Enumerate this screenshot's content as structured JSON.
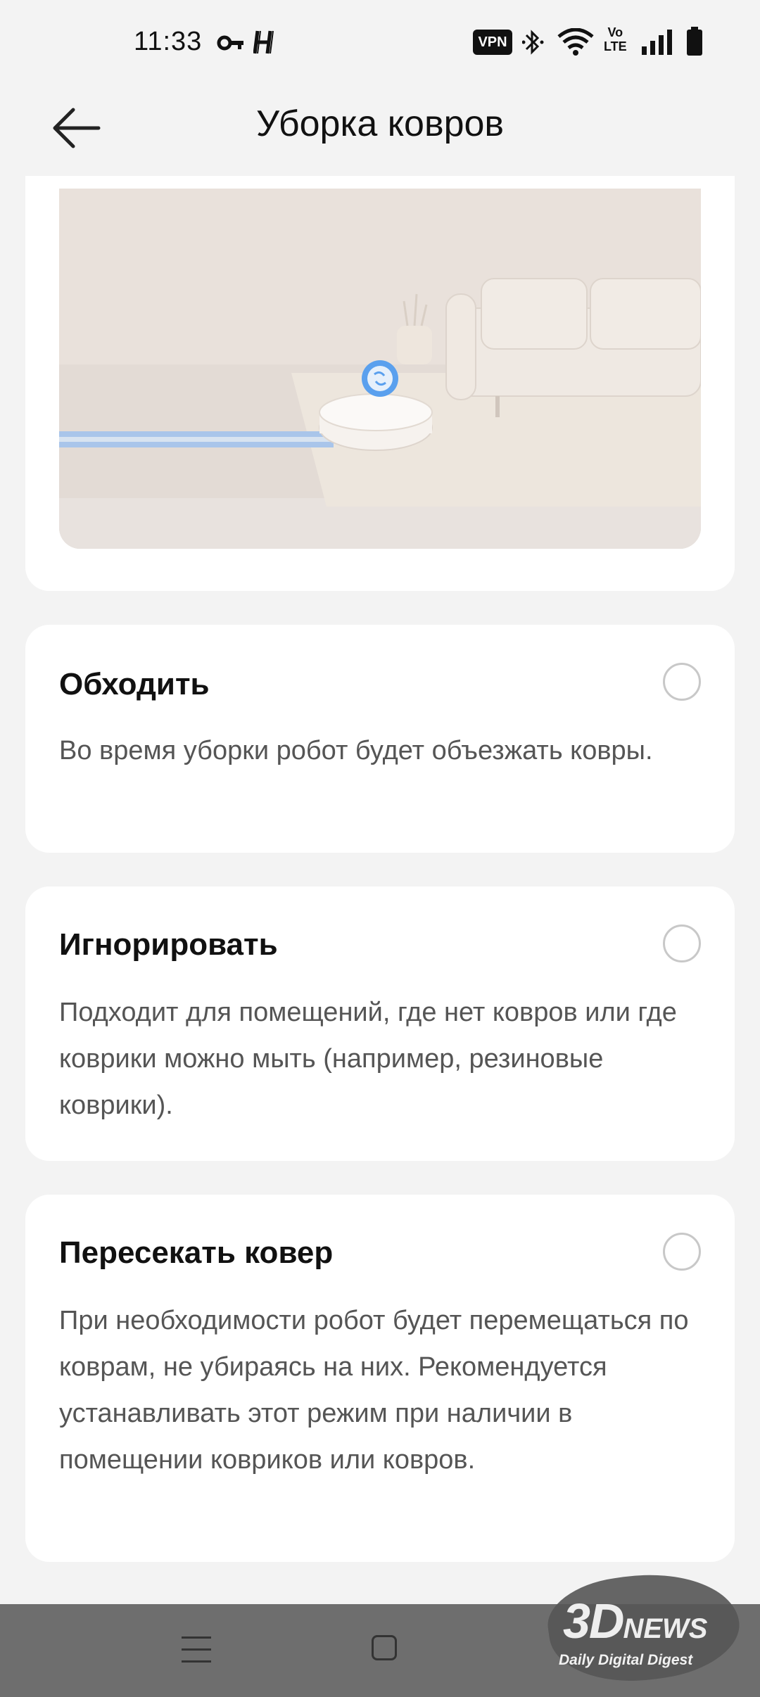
{
  "status_bar": {
    "time": "11:33",
    "vpn": "VPN",
    "volte_top": "Vo",
    "volte_bottom": "LTE"
  },
  "header": {
    "title": "Уборка ковров"
  },
  "options": [
    {
      "title": "Обходить",
      "description": "Во время уборки робот будет объезжать ковры.",
      "selected": false
    },
    {
      "title": "Игнорировать",
      "description": "Подходит для помещений, где нет ковров или где коврики можно мыть (например, резиновые коврики).",
      "selected": false
    },
    {
      "title": "Пересекать ковер",
      "description": "При необходимости робот будет перемещаться по коврам, не убираясь на них. Рекомендуется устанавливать этот режим при наличии в помещении ковриков или ковров.",
      "selected": false
    }
  ],
  "watermark": {
    "main": "3D",
    "main_suffix": "NEWS",
    "sub": "Daily Digital Digest"
  },
  "colors": {
    "background": "#f3f3f3",
    "card": "#ffffff",
    "path_blue": "#9cc0ea",
    "nav_bar": "#6e6e6e"
  }
}
